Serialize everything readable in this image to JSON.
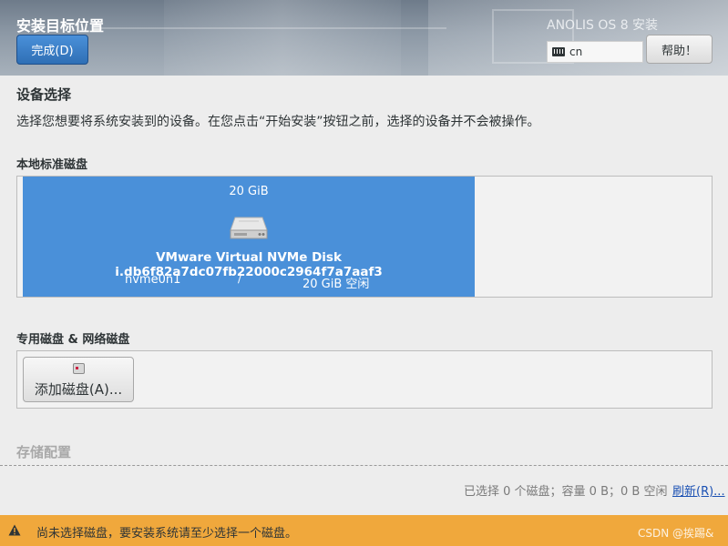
{
  "header": {
    "title": "安装目标位置",
    "done_label": "完成(D)",
    "product": "ANOLIS OS 8 安装",
    "keyboard_layout": "cn",
    "help_label": "帮助！"
  },
  "device_selection": {
    "title": "设备选择",
    "description": "选择您想要将系统安装到的设备。在您点击“开始安装”按钮之前，选择的设备并不会被操作。"
  },
  "local_disks": {
    "label": "本地标准磁盘",
    "disks": [
      {
        "size": "20 GiB",
        "name": "VMware Virtual NVMe Disk i.db6f82a7dc07fb22000c2964f7a7aaf3",
        "device": "nvme0n1",
        "separator": "/",
        "free": "20 GiB 空闲",
        "selected": true
      }
    ]
  },
  "special_disks": {
    "label": "专用磁盘 & 网络磁盘",
    "add_label": "添加磁盘(A)..."
  },
  "storage_config": {
    "label": "存储配置"
  },
  "footer": {
    "summary": "已选择 0 个磁盘；容量 0 B；0 B 空闲",
    "refresh_label": "刷新(R)..."
  },
  "warning": {
    "text": "尚未选择磁盘，要安装系统请至少选择一个磁盘。",
    "watermark": "CSDN @挨踢&"
  },
  "colors": {
    "accent": "#4a90d9",
    "warning": "#f0a83c",
    "link": "#1a50b3"
  }
}
